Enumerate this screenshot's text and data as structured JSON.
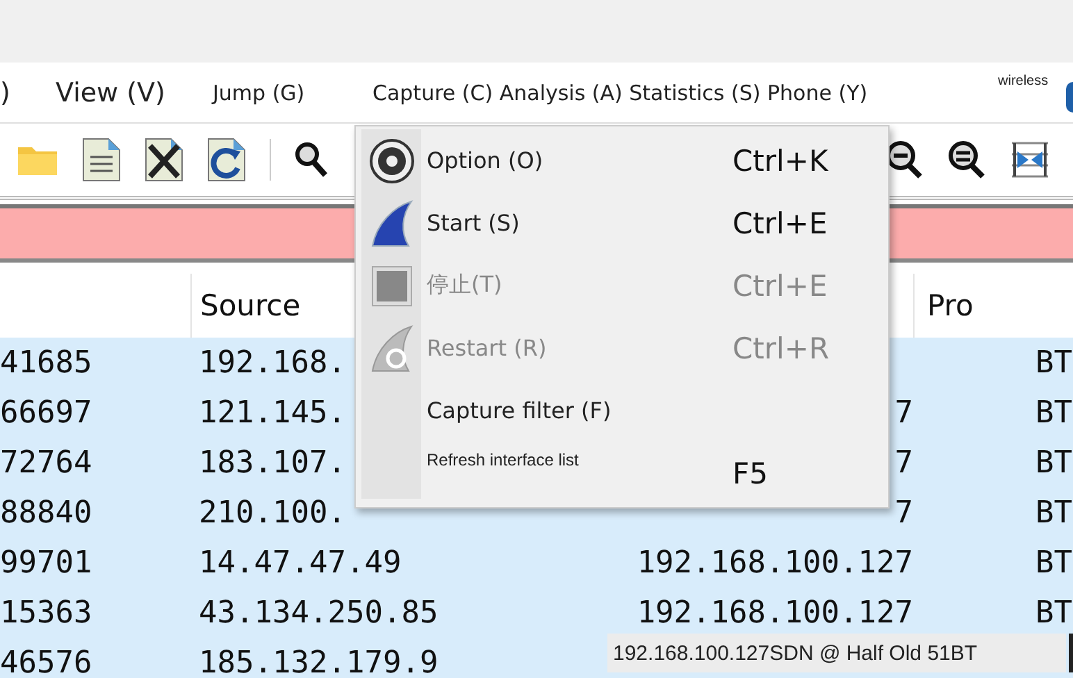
{
  "menubar": [
    {
      "label": ")"
    },
    {
      "label": "View (V)"
    },
    {
      "label": "Jump (G)"
    },
    {
      "label": "Capture (C) Analysis (A) Statistics (S) Phone (Y)"
    },
    {
      "label": "wireless"
    }
  ],
  "table": {
    "headers": {
      "source": "Source",
      "column_4": "Pro"
    },
    "rows": [
      {
        "column_1": "41685",
        "source": "192.168.",
        "column_4": "BT"
      },
      {
        "column_1": "66697",
        "source": "121.145.",
        "destination": "7",
        "column_4": "BT"
      },
      {
        "column_1": "72764",
        "source": "183.107.",
        "destination": "7",
        "column_4": "BT"
      },
      {
        "column_1": "88840",
        "source": "210.100.",
        "destination": "7",
        "column_4": "BT"
      },
      {
        "column_1": "99701",
        "source": "14.47.47.49",
        "destination": "192.168.100.127",
        "column_4": "BT"
      },
      {
        "column_1": "15363",
        "source": "43.134.250.85",
        "destination": "192.168.100.127",
        "column_4": "BT"
      },
      {
        "column_1": "46576",
        "source": "185.132.179.9"
      }
    ]
  },
  "menu": {
    "items": [
      {
        "kind": "gear",
        "label": "Option (O)",
        "shortcut": "Ctrl+K",
        "disabled": false
      },
      {
        "kind": "fin",
        "label": "Start (S)",
        "shortcut": "Ctrl+E",
        "disabled": false
      },
      {
        "kind": "stop",
        "label": "停止(T)",
        "shortcut": "Ctrl+E",
        "disabled": true
      },
      {
        "kind": "restart",
        "label": "Restart (R)",
        "shortcut": "Ctrl+R",
        "disabled": true
      },
      {
        "kind": "none",
        "label": "Capture filter (F)",
        "disabled": false
      },
      {
        "kind": "none",
        "label": "Refresh interface list",
        "shortcut": "F5",
        "disabled": false
      }
    ]
  },
  "tooltip": "192.168.100.127SDN @ Half Old 51BT"
}
